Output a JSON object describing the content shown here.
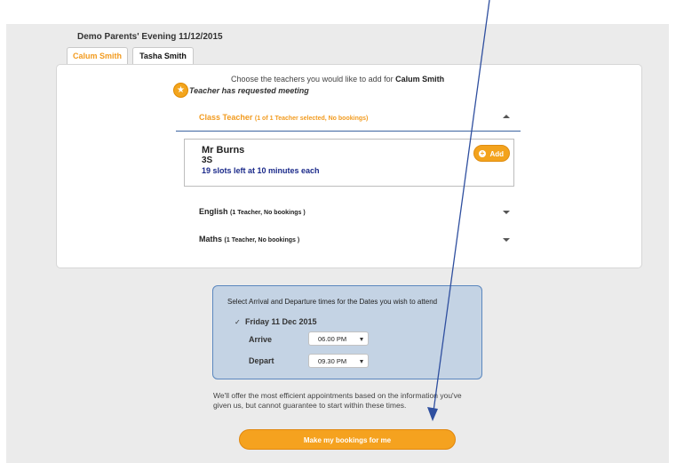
{
  "event": {
    "title": "Demo Parents' Evening 11/12/2015"
  },
  "tabs": [
    {
      "label": "Calum Smith"
    },
    {
      "label": "Tasha Smith"
    }
  ],
  "intro": {
    "choose_prefix": "Choose the teachers you would like to add for ",
    "student_name": "Calum Smith",
    "requested_legend": "Teacher has requested meeting"
  },
  "categories": [
    {
      "name": "Class Teacher",
      "meta": "(1 of 1 Teacher selected, No bookings)"
    },
    {
      "name": "English",
      "meta": "(1 Teacher, No bookings )"
    },
    {
      "name": "Maths",
      "meta": "(1 Teacher, No bookings )"
    }
  ],
  "teacher": {
    "name": "Mr Burns",
    "class": "3S",
    "slots": "19 slots left at 10 minutes each",
    "add_label": "Add"
  },
  "arrival": {
    "heading": "Select Arrival and Departure times for the Dates you wish to attend",
    "date": "Friday 11 Dec 2015",
    "arrive_label": "Arrive",
    "arrive_value": "06.00 PM",
    "depart_label": "Depart",
    "depart_value": "09.30 PM"
  },
  "offer_text": "We'll offer the most efficient appointments based on the information you've given us, but cannot guarantee to start within these times.",
  "make_button": "Make my bookings for me",
  "colors": {
    "accent": "#f29b1f",
    "link": "#1b2a8a",
    "box": "#c4d3e4",
    "arrow": "#2f4f9f"
  }
}
